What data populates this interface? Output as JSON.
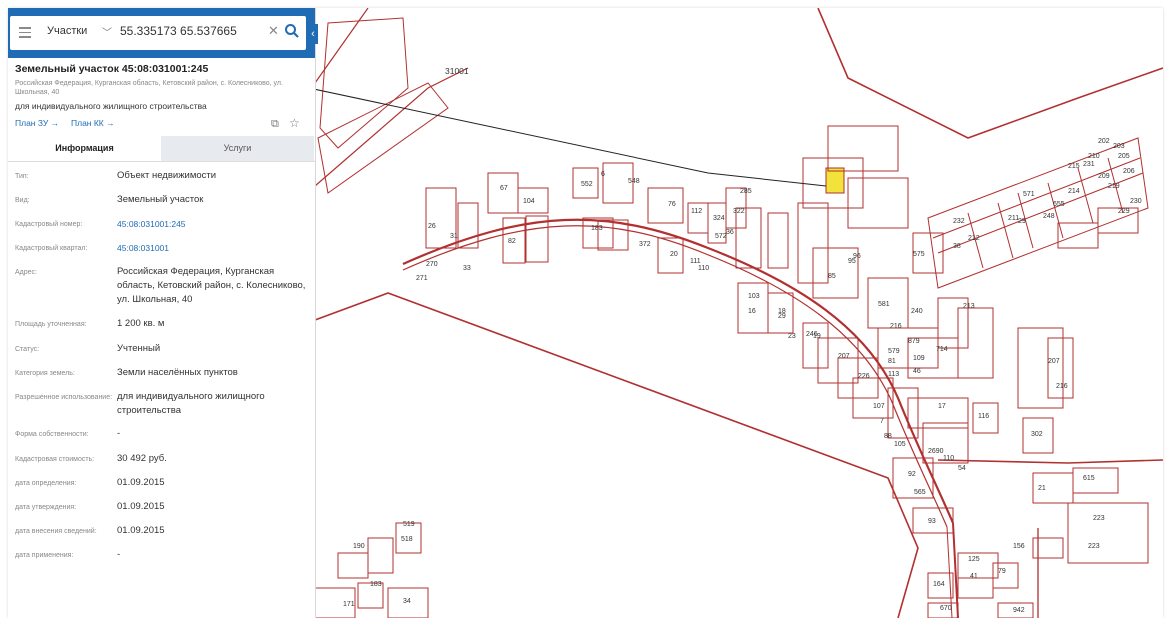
{
  "search": {
    "layer": "Участки",
    "query": "55.335173 65.537665"
  },
  "object": {
    "title": "Земельный участок 45:08:031001:245",
    "address": "Российская Федерация, Курганская область, Кетовский район, с. Колесниково, ул. Школьная, 40",
    "use": "для индивидуального жилищного строительства",
    "link_plan_zu": "План ЗУ →",
    "link_plan_kk": "План КК →"
  },
  "tabs": {
    "info": "Информация",
    "services": "Услуги"
  },
  "fields": [
    {
      "label": "Тип:",
      "value": "Объект недвижимости"
    },
    {
      "label": "Вид:",
      "value": "Земельный участок"
    },
    {
      "label": "Кадастровый номер:",
      "value": "45:08:031001:245"
    },
    {
      "label": "Кадастровый квартал:",
      "value": "45:08:031001"
    },
    {
      "label": "Адрес:",
      "value": "Российская Федерация, Курганская область, Кетовский район, с. Колесниково, ул. Школьная, 40"
    },
    {
      "label": "Площадь уточненная:",
      "value": "1 200 кв. м"
    },
    {
      "label": "Статус:",
      "value": "Учтенный"
    },
    {
      "label": "Категория земель:",
      "value": "Земли населённых пунктов"
    },
    {
      "label": "Разрешенное использование:",
      "value": "для индивидуального жилищного строительства"
    },
    {
      "label": "Форма собственности:",
      "value": "-"
    },
    {
      "label": "Кадастровая стоимость:",
      "value": "30 492 руб."
    },
    {
      "label": "дата определения:",
      "value": "01.09.2015"
    },
    {
      "label": "дата утверждения:",
      "value": "01.09.2015"
    },
    {
      "label": "дата внесения сведений:",
      "value": "01.09.2015"
    },
    {
      "label": "дата применения:",
      "value": "-"
    }
  ],
  "map": {
    "quarter_label": "31001",
    "parcel_numbers": [
      "104",
      "67",
      "76",
      "112",
      "548",
      "6",
      "552",
      "82",
      "183",
      "372",
      "20",
      "111",
      "110",
      "18",
      "103",
      "16",
      "29",
      "246",
      "324",
      "322",
      "572",
      "285",
      "36",
      "95",
      "85",
      "96",
      "581",
      "240",
      "216",
      "579",
      "879",
      "81",
      "109",
      "113",
      "46",
      "714",
      "107",
      "7",
      "88",
      "105",
      "17",
      "116",
      "302",
      "2690",
      "110",
      "54",
      "92",
      "565",
      "93",
      "21",
      "615",
      "223",
      "223",
      "156",
      "125",
      "41",
      "79",
      "164",
      "670",
      "942",
      "190",
      "518",
      "519",
      "183",
      "171",
      "34",
      "26",
      "270",
      "271",
      "31",
      "33",
      "575",
      "232",
      "211",
      "214",
      "219",
      "229",
      "230",
      "231",
      "209",
      "215",
      "210",
      "202",
      "203",
      "205",
      "206",
      "207",
      "216",
      "571",
      "655",
      "226",
      "207",
      "19",
      "23",
      "248",
      "29",
      "213",
      "212",
      "38",
      "215",
      "234",
      "233"
    ],
    "accent_color": "#b02020",
    "highlight_color": "#f3e23c"
  },
  "colors": {
    "header": "#1f6cb4",
    "link": "#1f6cb4"
  }
}
